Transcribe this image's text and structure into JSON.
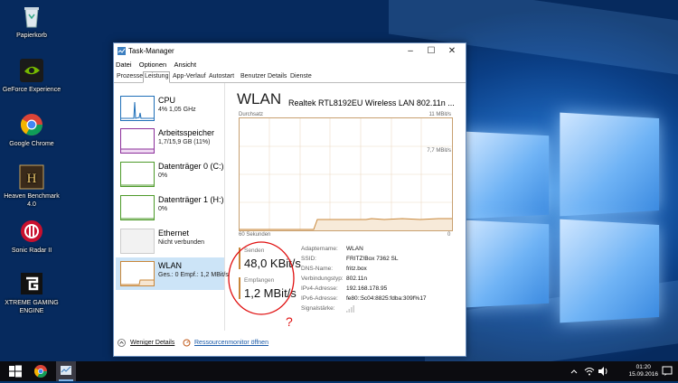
{
  "desktop": {
    "icons": [
      {
        "label": "Papierkorb",
        "icon": "recycle-bin-icon"
      },
      {
        "label": "GeForce Experience",
        "icon": "nvidia-icon"
      },
      {
        "label": "Google Chrome",
        "icon": "chrome-icon"
      },
      {
        "label": "Heaven Benchmark 4.0",
        "icon": "heaven-benchmark-icon"
      },
      {
        "label": "Sonic Radar II",
        "icon": "sonic-radar-icon"
      },
      {
        "label": "XTREME GAMING ENGINE",
        "icon": "gigabyte-icon"
      }
    ]
  },
  "window": {
    "title": "Task-Manager",
    "menu": [
      "Datei",
      "Optionen",
      "Ansicht"
    ],
    "tabs": [
      "Prozesse",
      "Leistung",
      "App-Verlauf",
      "Autostart",
      "Benutzer",
      "Details",
      "Dienste"
    ],
    "active_tab": "Leistung"
  },
  "sidebar": {
    "items": [
      {
        "name": "CPU",
        "sub": "4% 1,05 GHz",
        "color": "#1f6fb8"
      },
      {
        "name": "Arbeitsspeicher",
        "sub": "1,7/15,9 GB (11%)",
        "color": "#8b2f9a"
      },
      {
        "name": "Datenträger 0 (C:)",
        "sub": "0%",
        "color": "#4d9a2a"
      },
      {
        "name": "Datenträger 1 (H:)",
        "sub": "0%",
        "color": "#4d9a2a"
      },
      {
        "name": "Ethernet",
        "sub": "Nicht verbunden",
        "color": "#a0a0a0"
      },
      {
        "name": "WLAN",
        "sub": "Ges.: 0 Empf.: 1,2 MBit/s",
        "color": "#c8873a"
      }
    ]
  },
  "main": {
    "title": "WLAN",
    "adapter": "Realtek RTL8192EU Wireless LAN 802.11n ...",
    "graph_label": "Durchsatz",
    "graph_max": "11 MBit/s",
    "graph_mid": "7,7 MBit/s",
    "graph_time": "60 Sekunden",
    "graph_zero": "0",
    "send_label": "Senden",
    "send_value": "48,0 KBit/s",
    "recv_label": "Empfangen",
    "recv_value": "1,2 MBit/s",
    "details": [
      {
        "k": "Adaptername:",
        "v": "WLAN"
      },
      {
        "k": "SSID:",
        "v": "FRITZ!Box 7362 SL"
      },
      {
        "k": "DNS-Name:",
        "v": "fritz.box"
      },
      {
        "k": "Verbindungstyp:",
        "v": "802.11n"
      },
      {
        "k": "IPv4-Adresse:",
        "v": "192.168.178.95"
      },
      {
        "k": "IPv6-Adresse:",
        "v": "fe80::5c04:8825:fdba:309f%17"
      },
      {
        "k": "Signalstärke:",
        "v": ""
      }
    ],
    "annotation": "?"
  },
  "footer": {
    "fewer_details": "Weniger Details",
    "resource_monitor": "Ressourcenmonitor öffnen"
  },
  "taskbar": {
    "time": "01:20",
    "date": "15.09.2016"
  }
}
